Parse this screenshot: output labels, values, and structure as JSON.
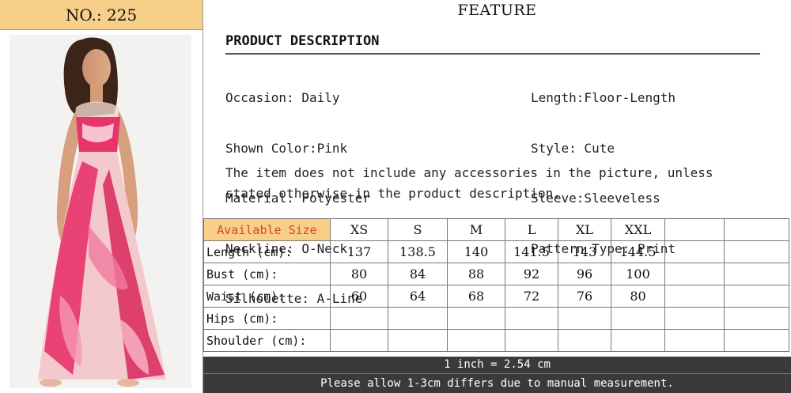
{
  "product_no": "NO.: 225",
  "feature_title": "FEATURE",
  "description_heading": "PRODUCT DESCRIPTION",
  "specs_left": [
    "Occasion: Daily",
    "Shown Color:Pink",
    "Material: Polyester",
    "Neckline: O-Neck",
    "Silhouette: A-Line"
  ],
  "specs_right": [
    "Length:Floor-Length",
    "Style: Cute",
    "Sleeve:Sleeveless",
    "Pattern Type: Print"
  ],
  "note_line1": "The item does not include any accessories in the picture, unless",
  "note_line2": "stated otherwise in the product description.",
  "size_table": {
    "header_label": "Available Size",
    "sizes": [
      "XS",
      "S",
      "M",
      "L",
      "XL",
      "XXL"
    ],
    "rows": [
      {
        "label": "Length (cm):",
        "values": [
          "137",
          "138.5",
          "140",
          "141.5",
          "143",
          "144.5"
        ]
      },
      {
        "label": "Bust (cm):",
        "values": [
          "80",
          "84",
          "88",
          "92",
          "96",
          "100"
        ]
      },
      {
        "label": "Waist (cm):",
        "values": [
          "60",
          "64",
          "68",
          "72",
          "76",
          "80"
        ]
      },
      {
        "label": "Hips (cm):",
        "values": [
          "",
          "",
          "",
          "",
          "",
          ""
        ]
      },
      {
        "label": "Shoulder (cm):",
        "values": [
          "",
          "",
          "",
          "",
          "",
          ""
        ]
      }
    ]
  },
  "conversion_note": "1 inch = 2.54 cm",
  "measurement_note": "Please allow 1-3cm differs due to manual measurement.",
  "colors": {
    "no_box_bg": "#f7cf88",
    "available_size_text": "#d24a1a",
    "footer_bar_bg": "#3a3a3a",
    "dress_pink": "#e8336b"
  }
}
